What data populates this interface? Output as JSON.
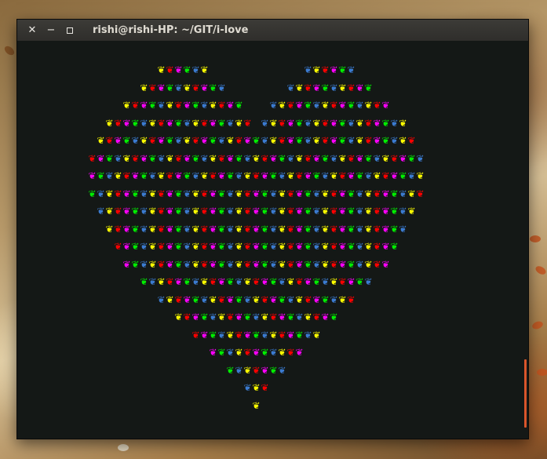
{
  "window": {
    "title": "rishi@rishi-HP: ~/GIT/i-love",
    "close_glyph": "✕",
    "minimize_glyph": "−"
  },
  "terminal": {
    "heart_glyph": "❦",
    "colors": [
      "#ffff00",
      "#ff00ff",
      "#3b7bd0",
      "#ff0000",
      "#00ee00"
    ],
    "rows": [
      [
        [
          199,
          6
        ],
        [
          386,
          6
        ]
      ],
      [
        [
          177,
          10
        ],
        [
          364,
          10
        ]
      ],
      [
        [
          155,
          14
        ],
        [
          342,
          14
        ]
      ],
      [
        [
          133,
          17
        ],
        [
          331,
          17
        ]
      ],
      [
        [
          122,
          37
        ]
      ],
      [
        [
          111,
          39
        ]
      ],
      [
        [
          111,
          39
        ]
      ],
      [
        [
          111,
          39
        ]
      ],
      [
        [
          122,
          37
        ]
      ],
      [
        [
          133,
          35
        ]
      ],
      [
        [
          144,
          33
        ]
      ],
      [
        [
          155,
          31
        ]
      ],
      [
        [
          177,
          27
        ]
      ],
      [
        [
          199,
          23
        ]
      ],
      [
        [
          221,
          19
        ]
      ],
      [
        [
          243,
          15
        ]
      ],
      [
        [
          265,
          11
        ]
      ],
      [
        [
          287,
          7
        ]
      ],
      [
        [
          309,
          3
        ]
      ],
      [
        [
          320,
          1
        ]
      ]
    ]
  }
}
